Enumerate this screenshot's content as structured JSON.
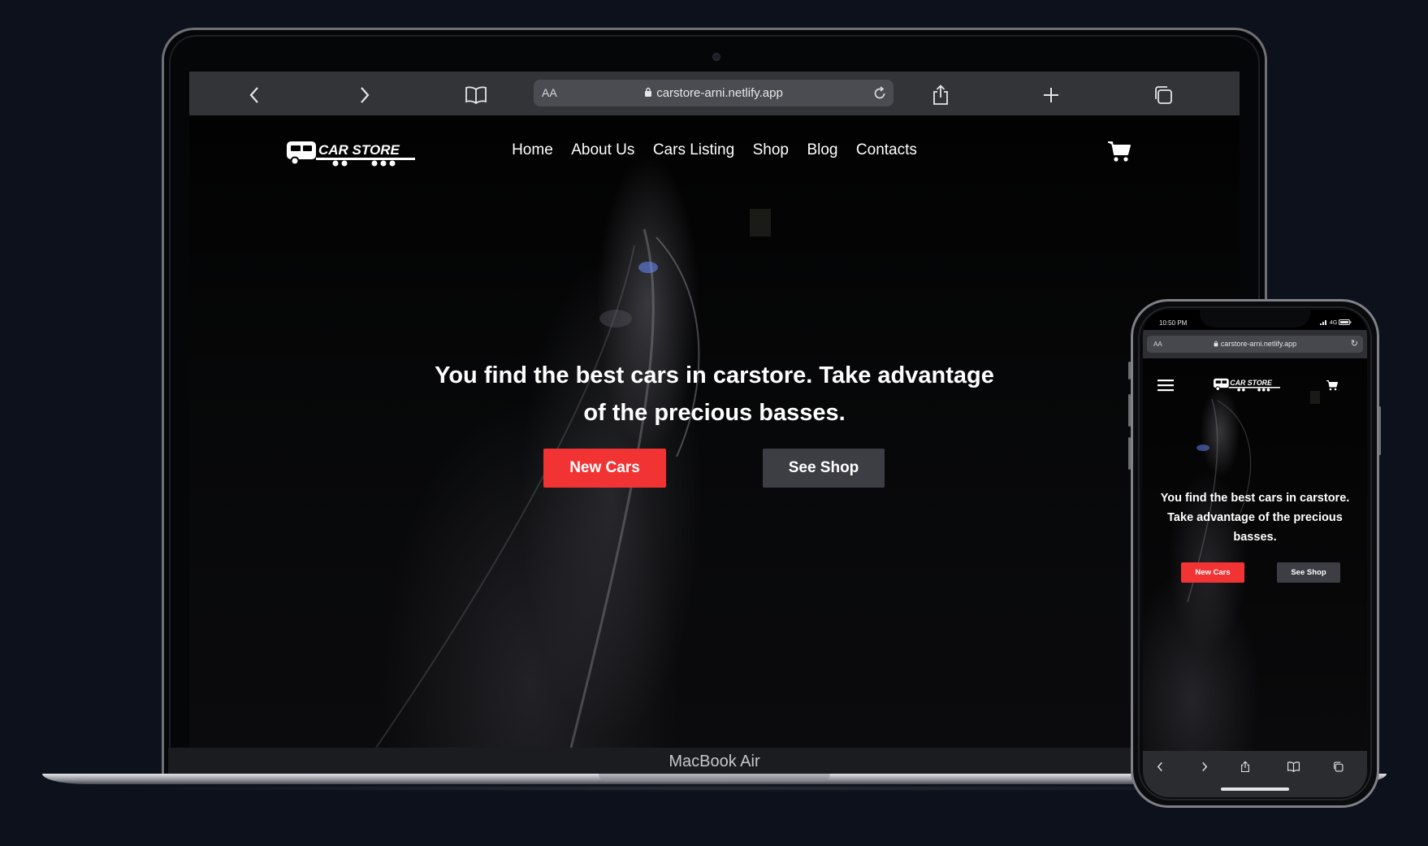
{
  "laptop": {
    "brand_label": "MacBook Air",
    "browser": {
      "aa_label": "AA",
      "url": "carstore-arni.netlify.app",
      "icons": [
        "chevron-left-icon",
        "chevron-right-icon",
        "book-icon",
        "lock-icon",
        "reload-icon",
        "share-icon",
        "plus-icon",
        "tabs-icon"
      ]
    },
    "site": {
      "logo_text": "CAR STORE",
      "nav": [
        "Home",
        "About Us",
        "Cars Listing",
        "Shop",
        "Blog",
        "Contacts"
      ],
      "hero_title": "You find the best cars in carstore. Take advantage of the precious basses.",
      "buttons": {
        "primary": "New Cars",
        "secondary": "See Shop"
      }
    }
  },
  "phone": {
    "status": {
      "time": "10:50 PM",
      "network": "4G"
    },
    "browser": {
      "aa_label": "AA",
      "url": "carstore-arni.netlify.app"
    },
    "site": {
      "logo_text": "CAR STORE",
      "hero_title": "You find the best cars in carstore. Take advantage of the precious basses.",
      "buttons": {
        "primary": "New Cars",
        "secondary": "See Shop"
      }
    }
  },
  "colors": {
    "accent": "#f23333",
    "secondary_button": "#3c3e44",
    "page_background": "#0d111b"
  }
}
